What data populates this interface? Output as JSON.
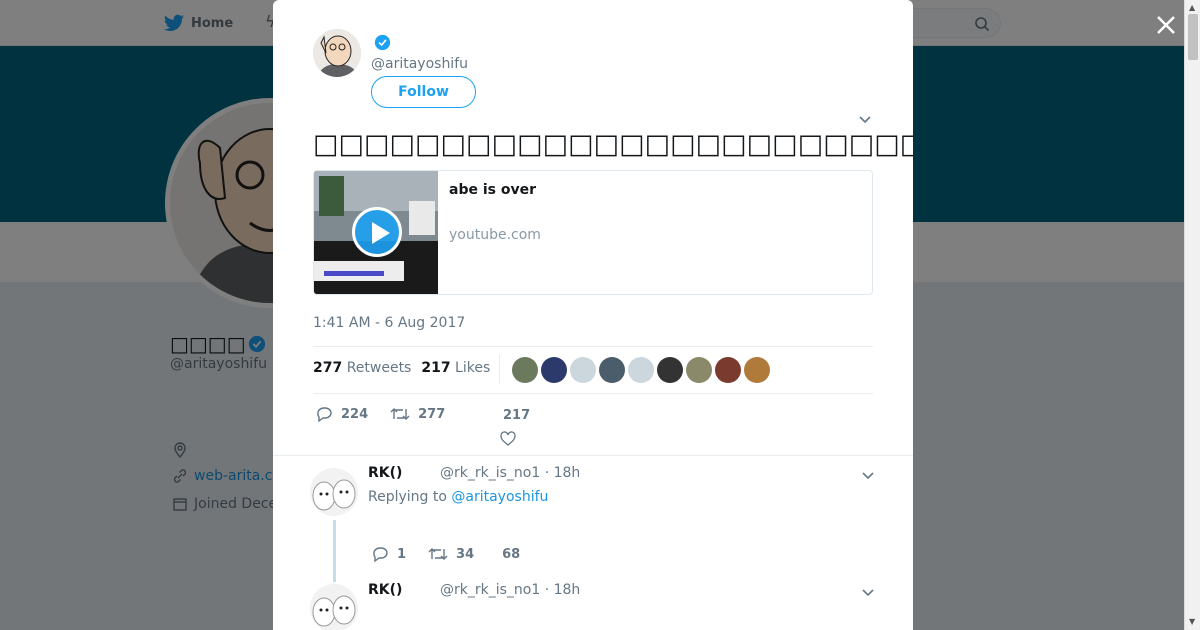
{
  "nav": {
    "home_label": "Home"
  },
  "background_profile": {
    "name": "□□□□",
    "handle": "@aritayoshifu",
    "link": "web-arita.co",
    "joined": "Joined Dece"
  },
  "tweet": {
    "handle": "@aritayoshifu",
    "follow_label": "Follow",
    "text": "□□□□□□□□□□□□□□□□□□□□□□□□□□□□□□□□□□□□□□□□□□□□□□□□",
    "card": {
      "title": "abe is over",
      "domain": "youtube.com"
    },
    "timestamp": "1:41 AM - 6 Aug 2017",
    "retweets_count": "277",
    "retweets_label": "Retweets",
    "likes_count": "217",
    "likes_label": "Likes",
    "reply_action_count": "224",
    "retweet_action_count": "277",
    "like_action_count": "217",
    "liker_avatar_colors": [
      "#6b7a5c",
      "#2b3a6b",
      "#ccd6dd",
      "#4b5d6b",
      "#ccd6dd",
      "#333333",
      "#8a8a6a",
      "#7a3b2e",
      "#b07a3a"
    ]
  },
  "replies": [
    {
      "name": "RK()",
      "handle": "@rk_rk_is_no1 · 18h",
      "replying_prefix": "Replying to",
      "replying_to": "@aritayoshifu",
      "reply_count": "1",
      "retweet_count": "34",
      "like_count": "68"
    },
    {
      "name": "RK()",
      "handle": "@rk_rk_is_no1 · 18h"
    }
  ],
  "colors": {
    "accent": "#1da1f2",
    "banner": "#00667f"
  }
}
